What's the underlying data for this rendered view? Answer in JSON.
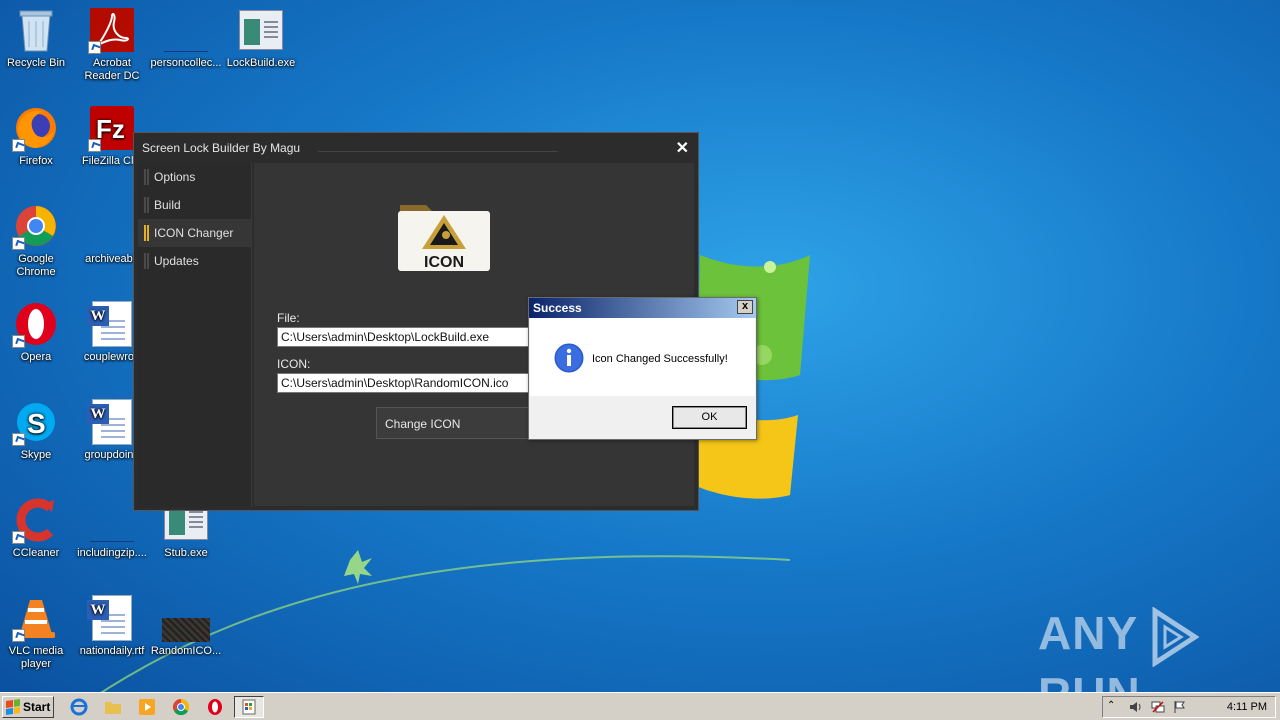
{
  "desktop": {
    "icons": [
      {
        "label": "Recycle Bin",
        "icon": "recycle-bin-icon"
      },
      {
        "label": "Acrobat Reader DC",
        "line1": "Acrobat",
        "line2": "Reader DC",
        "icon": "acrobat-icon"
      },
      {
        "label": "personcollec...",
        "icon": "blank-file-icon"
      },
      {
        "label": "LockBuild.exe",
        "icon": "exe-icon"
      },
      {
        "label": "Firefox",
        "icon": "firefox-icon"
      },
      {
        "label": "FileZilla Clie",
        "icon": "filezilla-icon"
      },
      {
        "label": "Google Chrome",
        "line1": "Google",
        "line2": "Chrome",
        "icon": "chrome-icon"
      },
      {
        "label": "archiveabo",
        "icon": "blank-file-icon"
      },
      {
        "label": "Opera",
        "icon": "opera-icon"
      },
      {
        "label": "couplewron",
        "icon": "word-doc-icon"
      },
      {
        "label": "Skype",
        "icon": "skype-icon"
      },
      {
        "label": "groupdoing",
        "icon": "word-doc-icon"
      },
      {
        "label": "CCleaner",
        "icon": "ccleaner-icon"
      },
      {
        "label": "includingzip....",
        "icon": "blank-file-icon"
      },
      {
        "label": "Stub.exe",
        "icon": "exe-icon"
      },
      {
        "label": "VLC media player",
        "line1": "VLC media",
        "line2": "player",
        "icon": "vlc-icon"
      },
      {
        "label": "nationdaily.rtf",
        "icon": "word-doc-icon"
      },
      {
        "label": "RandomICO...",
        "icon": "image-file-icon"
      }
    ]
  },
  "main_window": {
    "title": "Screen Lock Builder By Magu",
    "nav": [
      {
        "label": "Options",
        "active": false
      },
      {
        "label": "Build",
        "active": false
      },
      {
        "label": "ICON Changer",
        "active": true
      },
      {
        "label": "Updates",
        "active": false
      }
    ],
    "folder_icon_text": "ICON",
    "file_label": "File:",
    "file_value": "C:\\Users\\admin\\Desktop\\LockBuild.exe",
    "icon_label": "ICON:",
    "icon_value": "C:\\Users\\admin\\Desktop\\RandomICON.ico",
    "change_button": "Change ICON"
  },
  "dialog": {
    "title": "Success",
    "close": "x",
    "message": "Icon Changed Successfully!",
    "ok": "OK"
  },
  "taskbar": {
    "start": "Start",
    "clock": "4:11 PM"
  },
  "watermark": {
    "left": "ANY",
    "right": "RUN"
  },
  "colors": {
    "accent_active": "#e2b023",
    "window_bg": "#2c2c2c",
    "dialog_title": "#0a246a"
  }
}
